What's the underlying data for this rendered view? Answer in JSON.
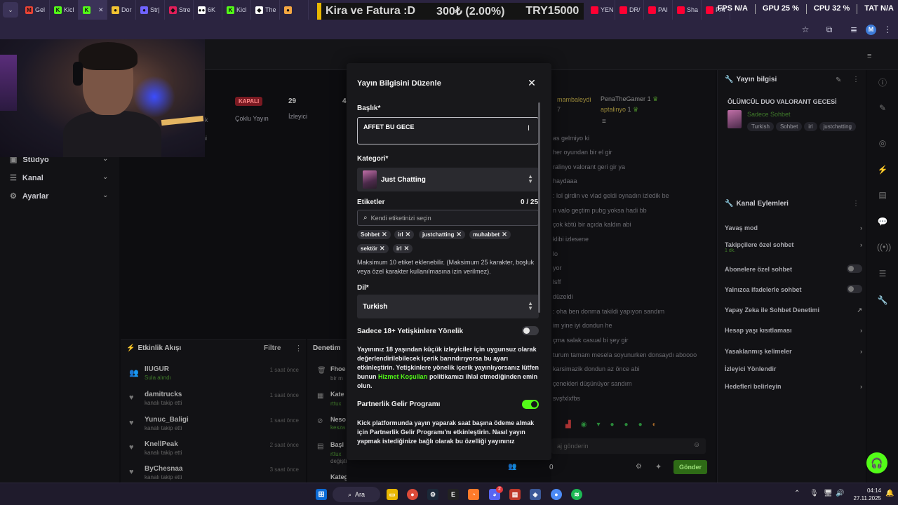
{
  "browser": {
    "tabs": [
      {
        "label": "Gel",
        "color": "#ea4335",
        "glyph": "M"
      },
      {
        "label": "Kicl",
        "color": "#53fc18",
        "glyph": "K"
      },
      {
        "label": "",
        "color": "#53fc18",
        "glyph": "K",
        "active": true
      },
      {
        "label": "Dor",
        "color": "#f1c232",
        "glyph": "●"
      },
      {
        "label": "Strj",
        "color": "#6f63ff",
        "glyph": "●"
      },
      {
        "label": "Stre",
        "color": "#e01e5a",
        "glyph": "◆"
      },
      {
        "label": "6K",
        "color": "#ffffff",
        "glyph": "●●"
      },
      {
        "label": "Kicl",
        "color": "#53fc18",
        "glyph": "K"
      },
      {
        "label": "The",
        "color": "#ffffff",
        "glyph": "◆"
      },
      {
        "label": "",
        "color": "#f4a742",
        "glyph": "●"
      }
    ],
    "right_tabs": [
      {
        "label": "YEN",
        "color": "#ff0033"
      },
      {
        "label": "DR/",
        "color": "#ff0033"
      },
      {
        "label": "PAI",
        "color": "#ff0033"
      },
      {
        "label": "Sha",
        "color": "#ff0033"
      },
      {
        "label": "PAI",
        "color": "#ff0033"
      }
    ],
    "ticker": {
      "text1": "Kira ve Fatura :D",
      "text2": "300₺ (2.00%)",
      "text3": "TRY15000"
    },
    "stats": {
      "fps": "FPS N/A",
      "gpu": "GPU 25 %",
      "cpu": "CPU 32 %",
      "tat": "TAT N/A"
    },
    "profile_initial": "M"
  },
  "sidebar": {
    "items": [
      {
        "label": "Stüdyo"
      },
      {
        "label": "Kanal"
      },
      {
        "label": "Ayarlar"
      }
    ]
  },
  "status_row": {
    "badge": "KAPALI",
    "badge_sub": "Çoklu Yayın",
    "viewers": "29",
    "viewers_label": "İzleyici",
    "partial": "4",
    "partial_left1": "lik",
    "partial_left2": "ni"
  },
  "activity": {
    "title": "Etkinlik Akışı",
    "filter": "Filtre",
    "items": [
      {
        "name": "IIUGUR",
        "sub": "Sula alındı",
        "time": "1 saat önce"
      },
      {
        "name": "damitrucks",
        "sub": "kanalı takip etti",
        "time": "1 saat önce"
      },
      {
        "name": "Yunuc_Baligi",
        "sub": "kanalı takip etti",
        "time": "1 saat önce"
      },
      {
        "name": "KnellPeak",
        "sub": "kanalı takip etti",
        "time": "2 saat önce"
      },
      {
        "name": "ByChesnaa",
        "sub": "kanalı takip etti",
        "time": "3 saat önce"
      }
    ]
  },
  "moderation": {
    "title": "Denetim",
    "items": [
      {
        "name": "Fhoe",
        "sub": "bir m"
      },
      {
        "name": "Kate",
        "sub": "rttux"
      },
      {
        "name": "Neso",
        "sub": "kesza"
      },
      {
        "name": "Başl",
        "sub": "rttux"
      },
      {
        "name": "Kategori",
        "sub": ""
      }
    ],
    "extra": "değiştirdi"
  },
  "chat": {
    "top_users": [
      {
        "name": "mambaleydi",
        "count": "7"
      },
      {
        "name": "PenaTheGamer",
        "count": "1"
      },
      {
        "name": "aptalinyo",
        "count": "1"
      }
    ],
    "lines": [
      "as gelmiyo ki",
      "her oyundan bir el gir",
      "ralinyo valorant geri gir ya",
      "haydaaa",
      ": lol girdin ve vlad geldi oynadın izledik be",
      "n valo geçtim pubg yoksa hadi bb",
      "çok kötü bir açıda kaldın abi",
      "klibi izlesene",
      "lo",
      "yor",
      "lsff",
      "düzeldi",
      ": oha ben donma takildi yapıyon sandım",
      "im yine iyi dondun he",
      "çma salak casual bi şey gir",
      "turum tamam mesela soyunurken donsaydı aboooo",
      "karsimazik dondun az önce abi",
      "çenekleri düşünüyor sandım",
      "svşfxlxfbs"
    ],
    "input_placeholder": "aj gönderin",
    "send": "Gönder",
    "viewer_count": "0"
  },
  "info_panel": {
    "title": "Yayın bilgisi",
    "stream_title": "ÖLÜMCÜL DUO VALORANT GECESİ",
    "chat_mode": "Sadece Sohbet",
    "tags": [
      "Turkish",
      "Sohbet",
      "irl",
      "justchatting"
    ]
  },
  "channel_actions": {
    "title": "Kanal Eylemleri",
    "items": [
      {
        "label": "Yavaş mod",
        "control": "chevron"
      },
      {
        "label": "Takipçilere özel sohbet",
        "sub": "1 dk.",
        "control": "chevron"
      },
      {
        "label": "Abonelere özel sohbet",
        "control": "toggle"
      },
      {
        "label": "Yalnızca ifadelerle sohbet",
        "control": "toggle"
      },
      {
        "label": "Yapay Zeka ile Sohbet Denetimi",
        "control": "external"
      },
      {
        "label": "Hesap yaşı kısıtlaması",
        "control": "chevron"
      },
      {
        "label": "Yasaklanmış kelimeler",
        "control": "chevron"
      },
      {
        "label": "İzleyici Yönlendir",
        "control": "none"
      },
      {
        "label": "Hedefleri belirleyin",
        "control": "chevron"
      }
    ]
  },
  "modal": {
    "title": "Yayın Bilgisini Düzenle",
    "title_label": "Başlık*",
    "title_value": "AFFET BU GECE",
    "category_label": "Kategori*",
    "category_value": "Just Chatting",
    "tags_label": "Etiketler",
    "tags_count": "0 / 25",
    "tags_placeholder": "Kendi etiketinizi seçin",
    "tags": [
      "Sohbet",
      "irl",
      "justchatting",
      "muhabbet",
      "sektör",
      "irl"
    ],
    "tags_help": "Maksimum 10 etiket eklenebilir. (Maksimum 25 karakter, boşluk veya özel karakter kullanılmasına izin verilmez).",
    "language_label": "Dil*",
    "language_value": "Turkish",
    "adult_label": "Sadece 18+ Yetişkinlere Yönelik",
    "adult_on": false,
    "adult_text_before": "Yayınınız 18 yaşından küçük izleyiciler için uygunsuz olarak değerlendirilebilecek içerik barındırıyorsa bu ayarı etkinleştirin. Yetişkinlere yönelik içerik yayınlıyorsanız lütfen bunun",
    "adult_text_link": "Hizmet Koşulları",
    "adult_text_after": "politikamızı ihlal etmediğinden emin olun.",
    "partner_label": "Partnerlik Gelir Programı",
    "partner_on": true,
    "partner_text": "Kick platformunda yayın yaparak saat başına ödeme almak için Partnerlik Gelir Programı'nı etkinleştirin. Nasıl yayın yapmak istediğinize bağlı olarak bu özelliği yayınınız"
  },
  "taskbar": {
    "search_label": "Ara",
    "time": "04:14",
    "date": "27.11.2025",
    "badges": {
      "discord": "2",
      "mail": "1"
    }
  },
  "colors": {
    "kick_green": "#53fc18",
    "modal_bg": "#18181b",
    "page_bg": "#0d0d10",
    "offline_red": "#7a1a22"
  }
}
